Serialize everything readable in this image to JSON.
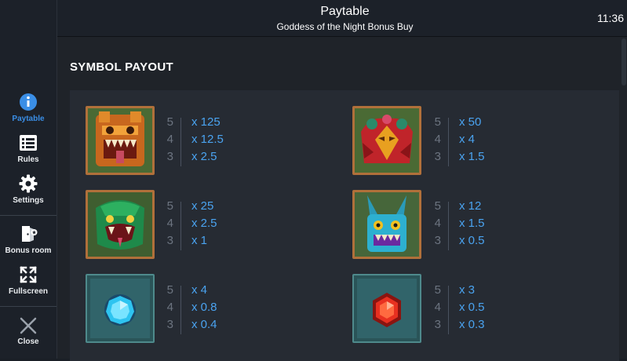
{
  "header": {
    "title": "Paytable",
    "subtitle": "Goddess of the Night Bonus Buy",
    "clock": "11:36"
  },
  "sidebar": {
    "items": [
      {
        "label": "Paytable",
        "icon": "info-icon",
        "active": true
      },
      {
        "label": "Rules",
        "icon": "list-icon",
        "active": false
      },
      {
        "label": "Settings",
        "icon": "gear-icon",
        "active": false
      },
      {
        "label": "Bonus room",
        "icon": "bonus-room-icon",
        "active": false
      },
      {
        "label": "Fullscreen",
        "icon": "fullscreen-icon",
        "active": false
      },
      {
        "label": "Close",
        "icon": "close-icon",
        "active": false
      }
    ]
  },
  "section_title": "SYMBOL PAYOUT",
  "symbols": [
    {
      "icon": "jaguar-mask-symbol",
      "pays": [
        {
          "count": "5",
          "value": "x 125"
        },
        {
          "count": "4",
          "value": "x 12.5"
        },
        {
          "count": "3",
          "value": "x 2.5"
        }
      ]
    },
    {
      "icon": "bird-mask-symbol",
      "pays": [
        {
          "count": "5",
          "value": "x 50"
        },
        {
          "count": "4",
          "value": "x 4"
        },
        {
          "count": "3",
          "value": "x 1.5"
        }
      ]
    },
    {
      "icon": "serpent-mask-symbol",
      "pays": [
        {
          "count": "5",
          "value": "x 25"
        },
        {
          "count": "4",
          "value": "x 2.5"
        },
        {
          "count": "3",
          "value": "x 1"
        }
      ]
    },
    {
      "icon": "rabbit-mask-symbol",
      "pays": [
        {
          "count": "5",
          "value": "x 12"
        },
        {
          "count": "4",
          "value": "x 1.5"
        },
        {
          "count": "3",
          "value": "x 0.5"
        }
      ]
    },
    {
      "icon": "blue-gem-symbol",
      "pays": [
        {
          "count": "5",
          "value": "x 4"
        },
        {
          "count": "4",
          "value": "x 0.8"
        },
        {
          "count": "3",
          "value": "x 0.4"
        }
      ]
    },
    {
      "icon": "red-gem-symbol",
      "pays": [
        {
          "count": "5",
          "value": "x 3"
        },
        {
          "count": "4",
          "value": "x 0.5"
        },
        {
          "count": "3",
          "value": "x 0.3"
        }
      ]
    }
  ],
  "colors": {
    "accent": "#3a8ee6",
    "payout_value": "#4aa3f0",
    "count": "#6c7480",
    "background": "#1f2329"
  }
}
